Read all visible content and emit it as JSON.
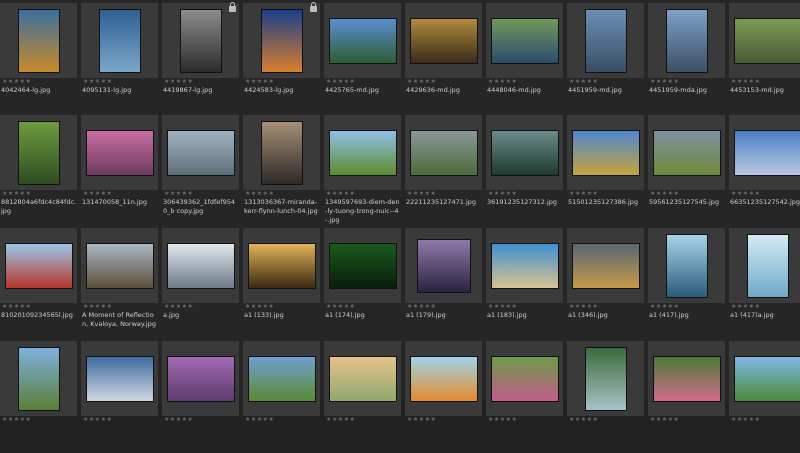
{
  "rating_glyph": "★★★★★",
  "rows": [
    [
      {
        "name": "4042464-lg.jpg",
        "orient": "port",
        "c1": "#3b6f9e",
        "c2": "#c98a2a",
        "lock": false
      },
      {
        "name": "4095131-lg.jpg",
        "orient": "port",
        "c1": "#2f5f95",
        "c2": "#7aa7c9",
        "lock": false
      },
      {
        "name": "4419867-lg.jpg",
        "orient": "port",
        "c1": "#8c8c8c",
        "c2": "#2c2c2c",
        "lock": true
      },
      {
        "name": "4424583-lg.jpg",
        "orient": "port",
        "c1": "#1b3f8a",
        "c2": "#d97e2d",
        "lock": true
      },
      {
        "name": "4425765-md.jpg",
        "orient": "land",
        "c1": "#5a8fd1",
        "c2": "#2f5c34",
        "lock": false
      },
      {
        "name": "4429636-md.jpg",
        "orient": "land",
        "c1": "#b08a3e",
        "c2": "#3a2c17",
        "lock": false
      },
      {
        "name": "4448046-md.jpg",
        "orient": "land",
        "c1": "#6f9a5a",
        "c2": "#2c4b6b",
        "lock": false
      },
      {
        "name": "4451959-md.jpg",
        "orient": "port",
        "c1": "#6d8fb5",
        "c2": "#394d64",
        "lock": false
      },
      {
        "name": "4451959-mda.jpg",
        "orient": "port",
        "c1": "#7ea1c8",
        "c2": "#3c4f66",
        "lock": false
      },
      {
        "name": "4453153-md.jpg",
        "orient": "land",
        "c1": "#7c9a56",
        "c2": "#4a5b35",
        "lock": false
      }
    ],
    [
      {
        "name": "8812804a6fdc4c84fdc.jpg",
        "orient": "port",
        "c1": "#6d9b3e",
        "c2": "#2f4d23",
        "lock": false
      },
      {
        "name": "131470058_11n.jpg",
        "orient": "land",
        "c1": "#c96ea6",
        "c2": "#6e3a5e",
        "lock": false
      },
      {
        "name": "306439362_1fdfef9540_b copy.jpg",
        "orient": "land",
        "c1": "#9fb3c2",
        "c2": "#5f6f7a",
        "lock": false
      },
      {
        "name": "1313036367-miranda-kerr-flynn-lunch-04.jpg",
        "orient": "port",
        "c1": "#a58e76",
        "c2": "#2d2a28",
        "lock": false
      },
      {
        "name": "1349597693-diem-den-ly-tuong-trong-nuic--4-.jpg",
        "orient": "land",
        "c1": "#8fc0e8",
        "c2": "#5d8a2d",
        "lock": false
      },
      {
        "name": "22211235127471.jpg",
        "orient": "land",
        "c1": "#8a9698",
        "c2": "#4d6b3a",
        "lock": false
      },
      {
        "name": "36191235127312.jpg",
        "orient": "land",
        "c1": "#6b8b8a",
        "c2": "#1f3a2d",
        "lock": false
      },
      {
        "name": "51501235127386.jpg",
        "orient": "land",
        "c1": "#4f86d0",
        "c2": "#c6a43a",
        "lock": false
      },
      {
        "name": "59561235127545.jpg",
        "orient": "land",
        "c1": "#7f8ea1",
        "c2": "#6e8b38",
        "lock": false
      },
      {
        "name": "66351235127542.jpg",
        "orient": "land",
        "c1": "#4a7fc4",
        "c2": "#b9c9e0",
        "lock": false
      }
    ],
    [
      {
        "name": "81020109234565l.jpg",
        "orient": "land",
        "c1": "#9cc6e8",
        "c2": "#b5362c",
        "lock": false
      },
      {
        "name": "A Moment of Reflection, Kvaloya, Norway.jpg",
        "orient": "land",
        "c1": "#aab7c4",
        "c2": "#5c4f3b",
        "lock": false
      },
      {
        "name": "a.jpg",
        "orient": "land",
        "c1": "#dfe6ee",
        "c2": "#6e7a88",
        "lock": false
      },
      {
        "name": "a1 (133).jpg",
        "orient": "land",
        "c1": "#e2b45a",
        "c2": "#3a2813",
        "lock": false
      },
      {
        "name": "a1 (174).jpg",
        "orient": "land",
        "c1": "#1a5a1e",
        "c2": "#0a1d0b",
        "lock": false
      },
      {
        "name": "a1 (179).jpg",
        "orient": "sq",
        "c1": "#8f7aa8",
        "c2": "#2a2240",
        "lock": false
      },
      {
        "name": "a1 (183).jpg",
        "orient": "land",
        "c1": "#3f8fd1",
        "c2": "#d9c28f",
        "lock": false
      },
      {
        "name": "a1 (346).jpg",
        "orient": "land",
        "c1": "#5b6672",
        "c2": "#c49a4a",
        "lock": false
      },
      {
        "name": "a1 (417).jpg",
        "orient": "port",
        "c1": "#a7d4e8",
        "c2": "#2a5c7a",
        "lock": false
      },
      {
        "name": "a1 (417)a.jpg",
        "orient": "port",
        "c1": "#d3eaf4",
        "c2": "#6fa9c6",
        "lock": false
      }
    ],
    [
      {
        "name": "",
        "orient": "port",
        "c1": "#7fb0de",
        "c2": "#5b7f36",
        "lock": false
      },
      {
        "name": "",
        "orient": "land",
        "c1": "#3e6c9e",
        "c2": "#cfd8e2",
        "lock": false
      },
      {
        "name": "",
        "orient": "land",
        "c1": "#a36bb4",
        "c2": "#5d3c6e",
        "lock": false
      },
      {
        "name": "",
        "orient": "land",
        "c1": "#6f9fd1",
        "c2": "#5a8a33",
        "lock": false
      },
      {
        "name": "",
        "orient": "land",
        "c1": "#e7c28c",
        "c2": "#8ea86d",
        "lock": false
      },
      {
        "name": "",
        "orient": "land",
        "c1": "#9fd3ea",
        "c2": "#e48b2c",
        "lock": false
      },
      {
        "name": "",
        "orient": "land",
        "c1": "#6d9a48",
        "c2": "#c25c8a",
        "lock": false
      },
      {
        "name": "",
        "orient": "port",
        "c1": "#3d6b3b",
        "c2": "#a8c1c8",
        "lock": false
      },
      {
        "name": "",
        "orient": "land",
        "c1": "#4c7a3a",
        "c2": "#d46a8b",
        "lock": false
      },
      {
        "name": "",
        "orient": "land",
        "c1": "#7fb8e6",
        "c2": "#4b8a3a",
        "lock": false
      }
    ]
  ]
}
